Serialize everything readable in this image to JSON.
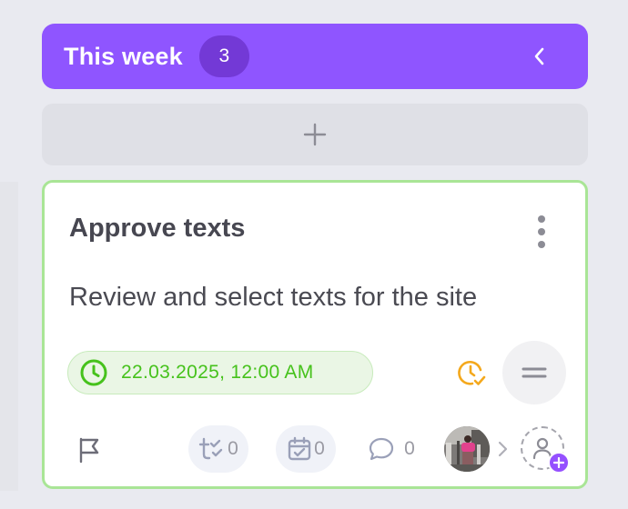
{
  "column": {
    "title": "This week",
    "count": "3",
    "accent_color": "#8f55ff",
    "collapse_icon": "chevron-left-icon",
    "add_icon": "plus-icon"
  },
  "card": {
    "title": "Approve texts",
    "description": "Review and select texts for the site",
    "due_date": "22.03.2025, 12:00 AM",
    "due_color": "#46c21c",
    "border_color": "#a9e596",
    "menu_icon": "kebab-menu-icon",
    "status_icon": "clock-check-icon",
    "priority_icon": "priority-medium-icon",
    "flag_icon": "flag-icon",
    "subtasks_count": "0",
    "calendar_count": "0",
    "comments_count": "0",
    "assign_icon": "add-user-icon"
  }
}
